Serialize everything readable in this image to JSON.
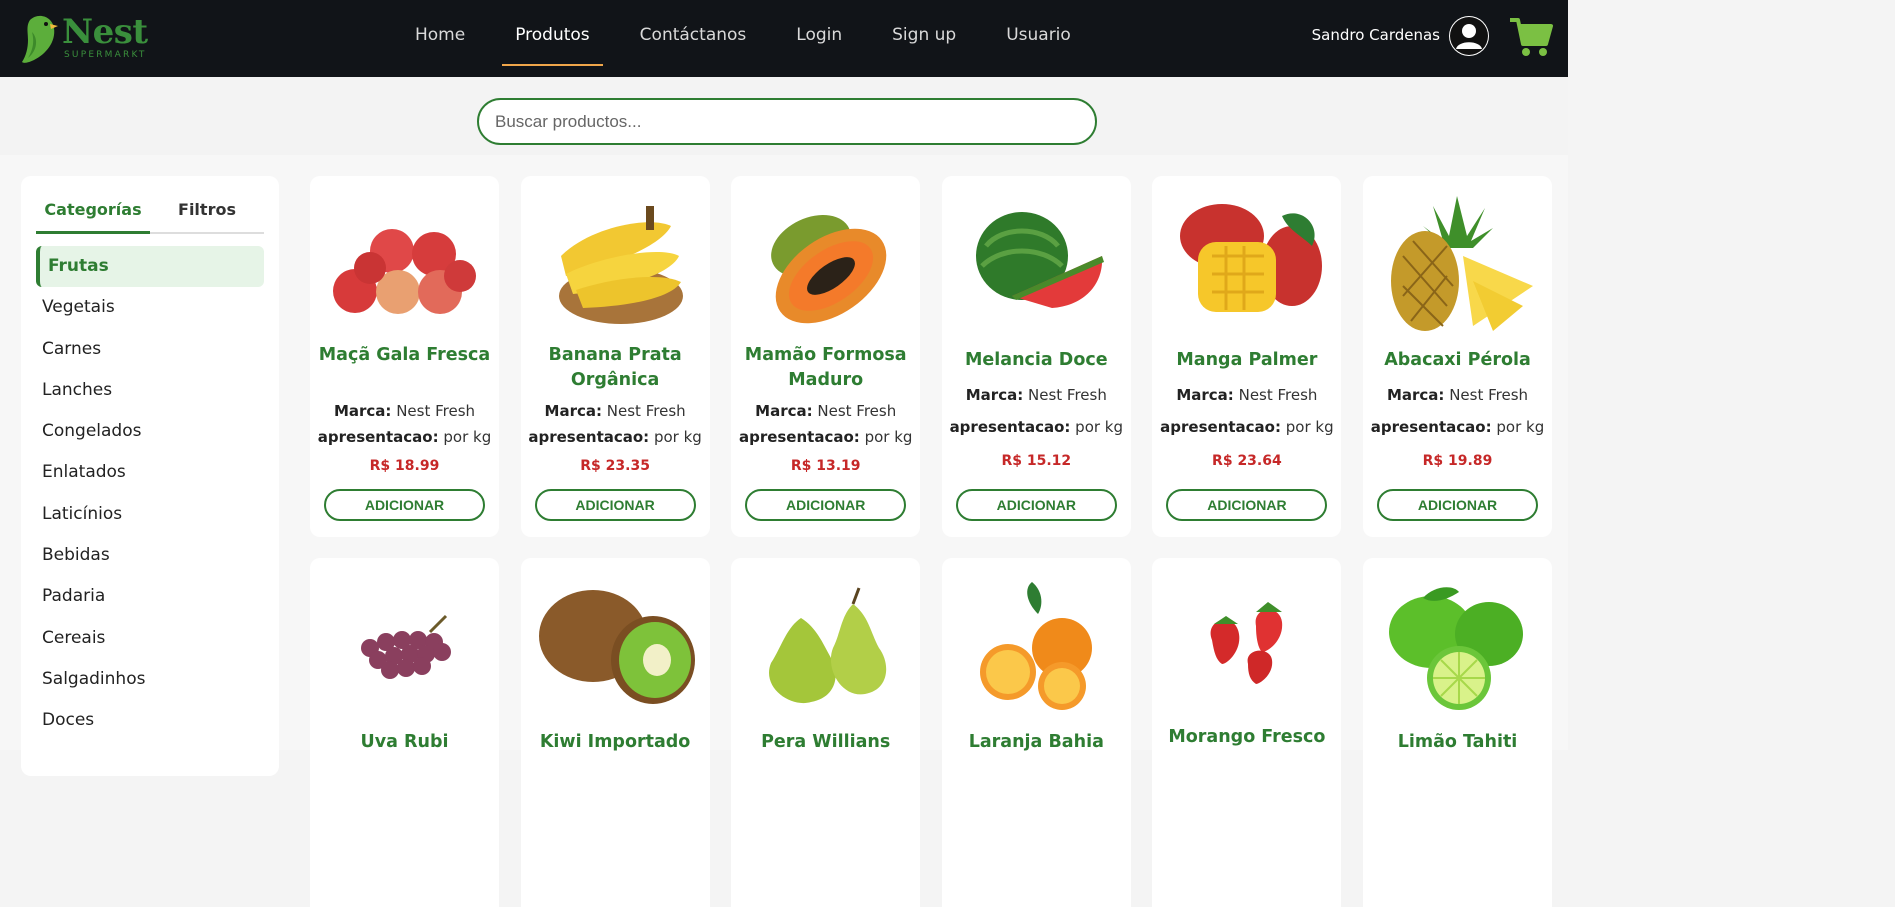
{
  "brand": {
    "name": "Nest",
    "tagline": "SUPERMARKT"
  },
  "nav": [
    "Home",
    "Produtos",
    "Contáctanos",
    "Login",
    "Sign up",
    "Usuario"
  ],
  "nav_active": "Produtos",
  "user": {
    "name": "Sandro Cardenas"
  },
  "search": {
    "placeholder": "Buscar productos...",
    "value": ""
  },
  "sidebar": {
    "tabs": [
      "Categorías",
      "Filtros"
    ],
    "active_tab": "Categorías",
    "categories": [
      "Frutas",
      "Vegetais",
      "Carnes",
      "Lanches",
      "Congelados",
      "Enlatados",
      "Laticínios",
      "Bebidas",
      "Padaria",
      "Cereais",
      "Salgadinhos",
      "Doces"
    ],
    "active_category": "Frutas"
  },
  "labels": {
    "brand": "Marca:",
    "presentation": "apresentacao:",
    "add": "ADICIONAR"
  },
  "products": [
    {
      "name": "Maçã Gala Fresca",
      "brand": "Nest Fresh",
      "presentation": "por kg",
      "price": "R$ 18.99",
      "image": "apple-image"
    },
    {
      "name": "Banana Prata Orgânica",
      "brand": "Nest Fresh",
      "presentation": "por kg",
      "price": "R$ 23.35",
      "image": "banana-image"
    },
    {
      "name": "Mamão Formosa Maduro",
      "brand": "Nest Fresh",
      "presentation": "por kg",
      "price": "R$ 13.19",
      "image": "papaya-image"
    },
    {
      "name": "Melancia Doce",
      "brand": "Nest Fresh",
      "presentation": "por kg",
      "price": "R$ 15.12",
      "image": "watermelon-image"
    },
    {
      "name": "Manga Palmer",
      "brand": "Nest Fresh",
      "presentation": "por kg",
      "price": "R$ 23.64",
      "image": "mango-image"
    },
    {
      "name": "Abacaxi Pérola",
      "brand": "Nest Fresh",
      "presentation": "por kg",
      "price": "R$ 19.89",
      "image": "pineapple-image"
    },
    {
      "name": "Uva Rubi",
      "image": "grape-image"
    },
    {
      "name": "Kiwi Importado",
      "image": "kiwi-image"
    },
    {
      "name": "Pera Willians",
      "image": "pear-image"
    },
    {
      "name": "Laranja Bahia",
      "image": "orange-image"
    },
    {
      "name": "Morango Fresco",
      "image": "strawberry-image"
    },
    {
      "name": "Limão Tahiti",
      "image": "lime-image"
    }
  ],
  "colors": {
    "header_bg": "#111418",
    "brand_green": "#2e7d32",
    "price_red": "#c62828",
    "nav_underline": "#f0a64a",
    "cart": "#7bc043"
  }
}
